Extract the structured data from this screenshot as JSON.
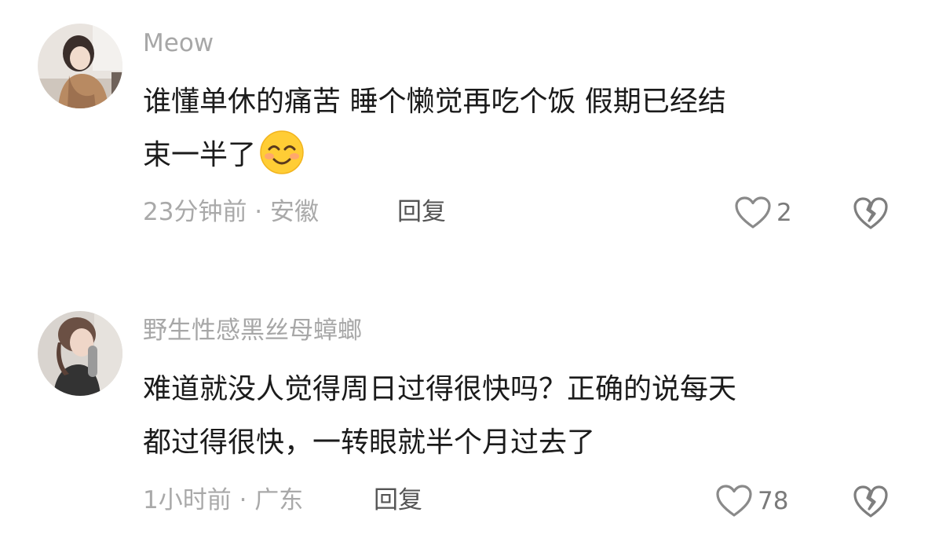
{
  "comments": [
    {
      "username": "Meow",
      "text_line1": "谁懂单休的痛苦  睡个懒觉再吃个饭  假期已经结",
      "text_line2": "束一半了",
      "emoji": "smiling-face-icon",
      "time_location": "23分钟前 · 安徽",
      "reply_label": "回复",
      "like_count": "2"
    },
    {
      "username": "野生性感黑丝母蟑螂",
      "text_line1": "难道就没人觉得周日过得很快吗？正确的说每天",
      "text_line2": "都过得很快，一转眼就半个月过去了",
      "time_location": "1小时前 · 广东",
      "reply_label": "回复",
      "like_count": "78"
    }
  ],
  "colors": {
    "username": "#a7a7a7",
    "text": "#1b1b1b",
    "meta": "#a9a9a9",
    "reply": "#555555",
    "icon": "#8a8a8a"
  }
}
